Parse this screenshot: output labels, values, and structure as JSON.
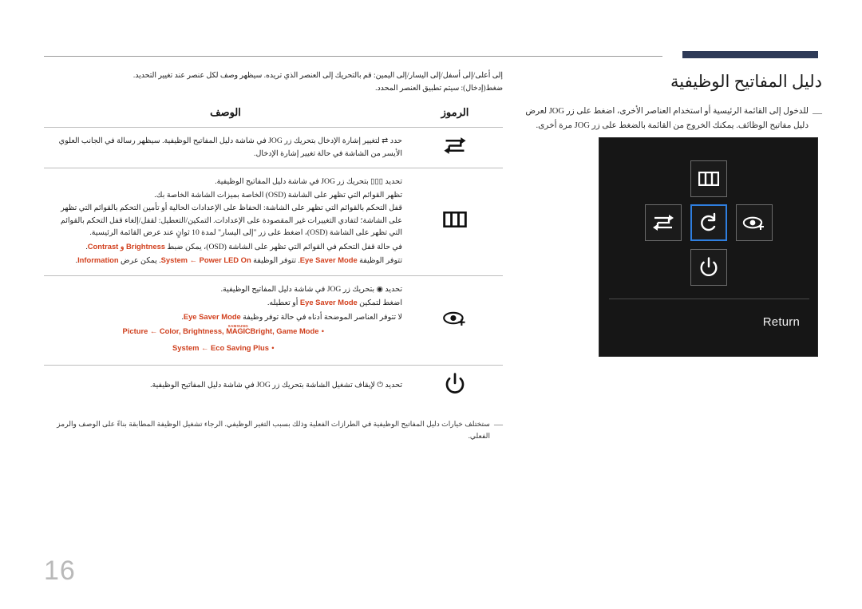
{
  "page": {
    "number": "16",
    "accent_navy": "#2e3a57",
    "accent_red": "#cf3f1d",
    "osd_highlight_blue": "#2f7fe0"
  },
  "header": {
    "title": "دليل المفاتيح الوظيفية",
    "note_marker": "―",
    "note": "للدخول إلى القائمة الرئيسية أو استخدام العناصر الأخرى، اضغط على زر JOG لعرض دليل مفاتيح الوظائف. يمكنك الخروج من القائمة بالضغط على زر JOG مرة أخرى."
  },
  "intro": {
    "line1": "إلى أعلى/إلى أسفل/إلى اليسار/إلى اليمين: قم بالتحريك إلى العنصر الذي تريده. سيظهر وصف لكل عنصر عند تغيير التحديد.",
    "line2": "ضغط(إدخال): سيتم تطبيق العنصر المحدد."
  },
  "osd": {
    "keys": [
      {
        "position": "up",
        "icon": "menu-icon",
        "selected": false
      },
      {
        "position": "left",
        "icon": "source-icon",
        "selected": false
      },
      {
        "position": "center",
        "icon": "return-icon",
        "selected": true
      },
      {
        "position": "right",
        "icon": "eye-saver-icon",
        "selected": false
      },
      {
        "position": "down",
        "icon": "power-icon",
        "selected": false
      }
    ],
    "caption": "Return"
  },
  "table": {
    "headers": {
      "symbols": "الرموز",
      "description": "الوصف"
    },
    "rows": [
      {
        "icon": "source-icon",
        "lines": [
          {
            "text": "حدد ⇄ لتغيير إشارة الإدخال بتحريك زر JOG في شاشة دليل المفاتيح الوظيفية. سيظهر رسالة في الجانب العلوي الأيسر من الشاشة في حالة تغيير إشارة الإدخال."
          }
        ]
      },
      {
        "icon": "menu-icon",
        "lines": [
          {
            "text": "تحديد ▯▯▯ بتحريك زر JOG في شاشة دليل المفاتيح الوظيفية."
          },
          {
            "text": "تظهر القوائم التي تظهر على الشاشة (OSD) الخاصة بميزات الشاشة الخاصة بك."
          },
          {
            "text": "قفل التحكم بالقوائم التي تظهر على الشاشة: الحفاظ على الإعدادات الحالية أو تأمين التحكم بالقوائم التي تظهر على الشاشة؛ لتفادي التغييرات غير المقصودة على الإعدادات. التمكين/التعطيل: لقفل/إلغاء قفل التحكم بالقوائم التي تظهر على الشاشة (OSD)، اضغط على زر \"إلى اليسار\" لمدة 10 ثوانٍ عند عرض القائمة الرئيسية."
          }
        ],
        "highlight_lines": [
          {
            "prefix": "في حالة قفل التحكم في القوائم التي تظهر على الشاشة (OSD)، يمكن ضبط ",
            "em": "Brightness و Contrast",
            "suffix": "."
          },
          {
            "prefix": "تتوفر الوظيفة ",
            "em": "Eye Saver Mode",
            "mid": ". تتوفر الوظيفة ",
            "em2": "System ← Power LED On",
            "mid2": ". يمكن عرض ",
            "em3": "Information",
            "suffix": "."
          }
        ]
      },
      {
        "icon": "eye-saver-icon",
        "lines": [
          {
            "text": "تحديد ◉ بتحريك زر JOG في شاشة دليل المفاتيح الوظيفية."
          }
        ],
        "highlight_lines": [
          {
            "prefix": "اضغط لتمكين ",
            "em": "Eye Saver Mode",
            "suffix": " أو تعطيله."
          },
          {
            "prefix": "لا تتوفر العناصر الموضحة أدناه في حالة توفر وظيفة ",
            "em": "Eye Saver Mode",
            "suffix": "."
          }
        ],
        "bullets": [
          {
            "magic_small": "SAMSUNG",
            "magic_big": "MAGIC",
            "text_before": "Picture ← Color, Brightness, ",
            "text_after": "Bright, Game Mode"
          },
          {
            "text": "System ← Eco Saving Plus"
          }
        ]
      },
      {
        "icon": "power-icon",
        "lines": [
          {
            "text": "تحديد ⏻ لإيقاف تشغيل الشاشة بتحريك زر JOG في شاشة دليل المفاتيح الوظيفية."
          }
        ]
      }
    ]
  },
  "footer": {
    "marker": "―",
    "note": "ستختلف خيارات دليل المفاتيح الوظيفية في الطرازات الفعلية وذلك بسبب التغير الوظيفي. الرجاء تشغيل الوظيفة المطابقة بناءً على الوصف والرمز الفعلي."
  }
}
